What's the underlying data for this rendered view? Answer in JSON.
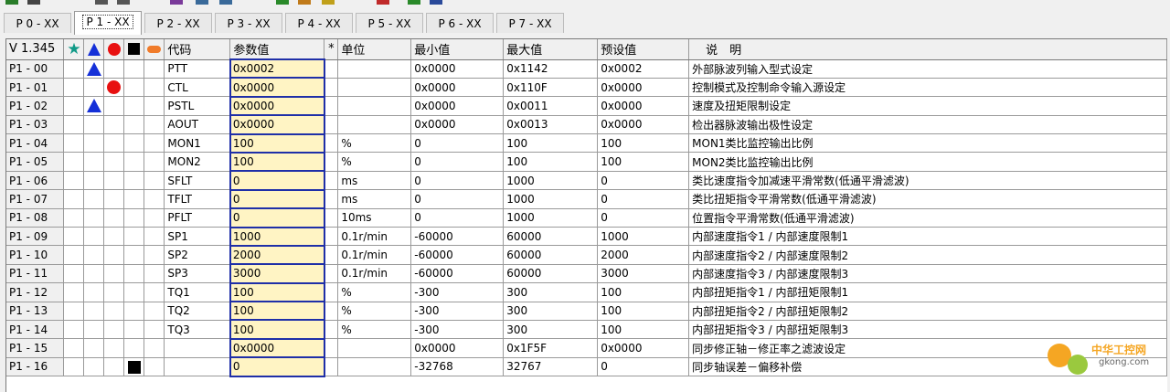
{
  "tabs": [
    "P 0 - XX",
    "P 1 - XX",
    "P 2 - XX",
    "P 3 - XX",
    "P 4 - XX",
    "P 5 - XX",
    "P 6 - XX",
    "P 7 - XX"
  ],
  "active_tab": 1,
  "header": {
    "version": "V 1.345",
    "code": "代码",
    "param_value": "参数值",
    "star_col": "*",
    "unit": "单位",
    "min": "最小值",
    "max": "最大值",
    "default": "预设值",
    "desc": "说　明"
  },
  "header_icons": [
    "star-icon",
    "triangle-icon",
    "circle-icon",
    "square-icon",
    "oval-icon"
  ],
  "colors": {
    "triangle": "#1530d8",
    "circle": "#e81010",
    "square": "#000000",
    "star": "#119a88",
    "oval": "#f07b2a",
    "param_border": "#1f2fa8",
    "param_bg": "#fff4c4"
  },
  "rows": [
    {
      "id": "P1 - 00",
      "icon": "triangle",
      "code": "PTT",
      "value": "0x0002",
      "unit": "",
      "min": "0x0000",
      "max": "0x1142",
      "default": "0x0002",
      "desc": "外部脉波列输入型式设定"
    },
    {
      "id": "P1 - 01",
      "icon": "circle",
      "code": "CTL",
      "value": "0x0000",
      "unit": "",
      "min": "0x0000",
      "max": "0x110F",
      "default": "0x0000",
      "desc": "控制模式及控制命令输入源设定"
    },
    {
      "id": "P1 - 02",
      "icon": "triangle",
      "code": "PSTL",
      "value": "0x0000",
      "unit": "",
      "min": "0x0000",
      "max": "0x0011",
      "default": "0x0000",
      "desc": "速度及扭矩限制设定"
    },
    {
      "id": "P1 - 03",
      "icon": "",
      "code": "AOUT",
      "value": "0x0000",
      "unit": "",
      "min": "0x0000",
      "max": "0x0013",
      "default": "0x0000",
      "desc": "检出器脉波输出极性设定"
    },
    {
      "id": "P1 - 04",
      "icon": "",
      "code": "MON1",
      "value": "100",
      "unit": "%",
      "min": "0",
      "max": "100",
      "default": "100",
      "desc": "MON1类比监控输出比例"
    },
    {
      "id": "P1 - 05",
      "icon": "",
      "code": "MON2",
      "value": "100",
      "unit": "%",
      "min": "0",
      "max": "100",
      "default": "100",
      "desc": "MON2类比监控输出比例"
    },
    {
      "id": "P1 - 06",
      "icon": "",
      "code": "SFLT",
      "value": "0",
      "unit": "ms",
      "min": "0",
      "max": "1000",
      "default": "0",
      "desc": "类比速度指令加减速平滑常数(低通平滑滤波)"
    },
    {
      "id": "P1 - 07",
      "icon": "",
      "code": "TFLT",
      "value": "0",
      "unit": "ms",
      "min": "0",
      "max": "1000",
      "default": "0",
      "desc": "类比扭矩指令平滑常数(低通平滑滤波)"
    },
    {
      "id": "P1 - 08",
      "icon": "",
      "code": "PFLT",
      "value": "0",
      "unit": " 10ms",
      "min": "0",
      "max": "1000",
      "default": "0",
      "desc": "位置指令平滑常数(低通平滑滤波)"
    },
    {
      "id": "P1 - 09",
      "icon": "",
      "code": "SP1",
      "value": "1000",
      "unit": "0.1r/min",
      "min": "-60000",
      "max": "60000",
      "default": "1000",
      "desc": "内部速度指令1 / 内部速度限制1"
    },
    {
      "id": "P1 - 10",
      "icon": "",
      "code": "SP2",
      "value": "2000",
      "unit": "0.1r/min",
      "min": "-60000",
      "max": "60000",
      "default": "2000",
      "desc": "内部速度指令2 / 内部速度限制2"
    },
    {
      "id": "P1 - 11",
      "icon": "",
      "code": "SP3",
      "value": "3000",
      "unit": "0.1r/min",
      "min": "-60000",
      "max": "60000",
      "default": "3000",
      "desc": "内部速度指令3 / 内部速度限制3"
    },
    {
      "id": "P1 - 12",
      "icon": "",
      "code": "TQ1",
      "value": "100",
      "unit": "%",
      "min": "-300",
      "max": "300",
      "default": "100",
      "desc": "内部扭矩指令1 / 内部扭矩限制1"
    },
    {
      "id": "P1 - 13",
      "icon": "",
      "code": "TQ2",
      "value": "100",
      "unit": "%",
      "min": "-300",
      "max": "300",
      "default": "100",
      "desc": "内部扭矩指令2 / 内部扭矩限制2"
    },
    {
      "id": "P1 - 14",
      "icon": "",
      "code": "TQ3",
      "value": "100",
      "unit": "%",
      "min": "-300",
      "max": "300",
      "default": "100",
      "desc": "内部扭矩指令3 / 内部扭矩限制3"
    },
    {
      "id": "P1 - 15",
      "icon": "",
      "code": "",
      "value": "0x0000",
      "unit": "",
      "min": "0x0000",
      "max": "0x1F5F",
      "default": "0x0000",
      "desc": "同步修正轴－修正率之滤波设定"
    },
    {
      "id": "P1 - 16",
      "icon": "square",
      "code": "",
      "value": "0",
      "unit": "",
      "min": "-32768",
      "max": "32767",
      "default": "0",
      "desc": "同步轴误差－偏移补偿"
    }
  ],
  "watermark": {
    "title": "中华工控网",
    "domain": "gkong.com"
  }
}
